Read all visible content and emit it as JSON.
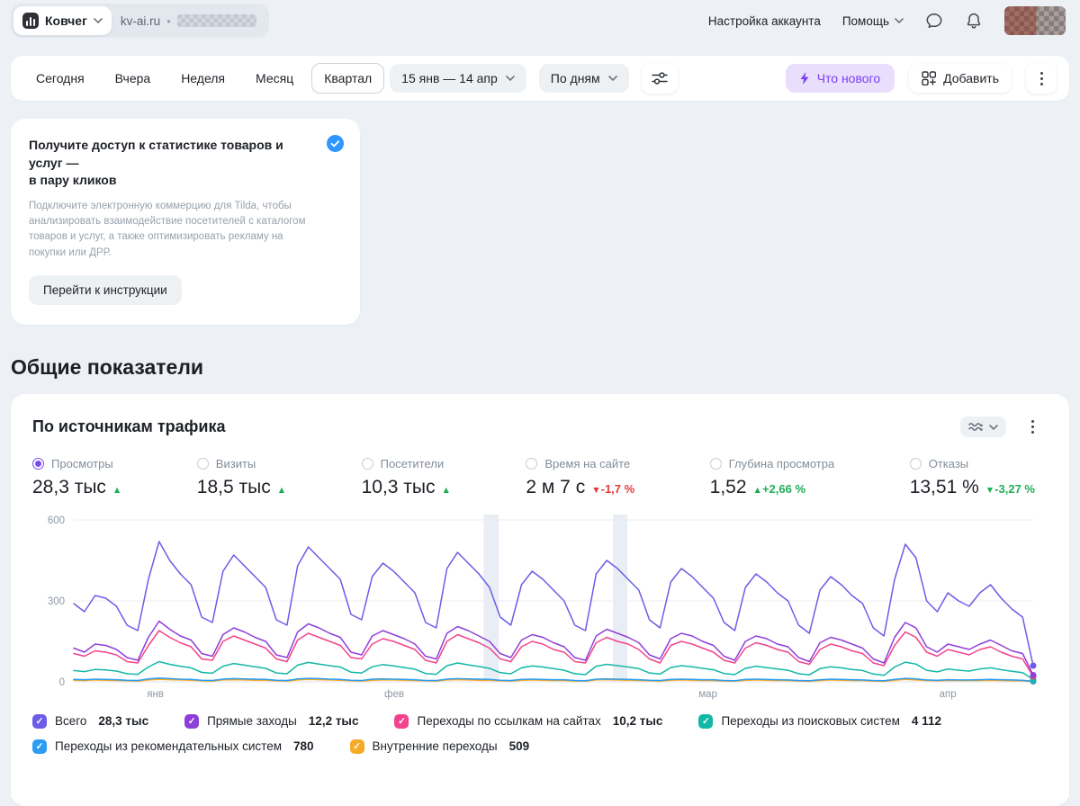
{
  "topbar": {
    "project_name": "Ковчег",
    "domain": "kv-ai.ru",
    "account_settings": "Настройка аккаунта",
    "help": "Помощь"
  },
  "toolbar": {
    "tabs": [
      {
        "label": "Сегодня",
        "active": false
      },
      {
        "label": "Вчера",
        "active": false
      },
      {
        "label": "Неделя",
        "active": false
      },
      {
        "label": "Месяц",
        "active": false
      },
      {
        "label": "Квартал",
        "active": true
      }
    ],
    "date_range": "15 янв — 14 апр",
    "granularity": "По дням",
    "whats_new": "Что нового",
    "add": "Добавить"
  },
  "promo": {
    "title_line1": "Получите доступ к статистике товаров и услуг —",
    "title_line2": "в пару кликов",
    "body": "Подключите электронную коммерцию для Tilda, чтобы анализировать взаимодействие посетителей с каталогом товаров и услуг, а также оптимизировать рекламу на покупки или ДРР.",
    "cta": "Перейти к инструкции"
  },
  "section_title": "Общие показатели",
  "card": {
    "title": "По источникам трафика",
    "metrics": [
      {
        "label": "Просмотры",
        "value": "28,3 тыс",
        "arrow": "▲",
        "delta": "",
        "trend_color": "#1fae55",
        "selected": true
      },
      {
        "label": "Визиты",
        "value": "18,5 тыс",
        "arrow": "▲",
        "delta": "",
        "trend_color": "#1fae55",
        "selected": false
      },
      {
        "label": "Посетители",
        "value": "10,3 тыс",
        "arrow": "▲",
        "delta": "",
        "trend_color": "#1fae55",
        "selected": false
      },
      {
        "label": "Время на сайте",
        "value": "2 м 7 с",
        "arrow": "▼",
        "delta": "-1,7 %",
        "trend_color": "#e8383d",
        "selected": false
      },
      {
        "label": "Глубина просмотра",
        "value": "1,52",
        "arrow": "▲",
        "delta": "+2,66 %",
        "trend_color": "#1fae55",
        "selected": false
      },
      {
        "label": "Отказы",
        "value": "13,51 %",
        "arrow": "▼",
        "delta": "-3,27 %",
        "trend_color": "#1fae55",
        "selected": false
      }
    ]
  },
  "colors": {
    "accent": "#7a4df0",
    "whats_new_bg": "#e9defc",
    "whats_new_text": "#7d3ff2",
    "positive": "#1fae55",
    "negative": "#e8383d",
    "promo_badge_blue": "#2e96ff"
  },
  "icons": {
    "project_logo": "metrica-bars",
    "chevrons": "chevron-down",
    "chat": "chat-bubble",
    "notifications": "bell",
    "filter": "sliders",
    "whats_new": "lightning",
    "add": "add-widget",
    "menu": "kebab",
    "chart_type": "waves",
    "promo_badge": "check-circle"
  },
  "chart_data": {
    "type": "line",
    "title": "По источникам трафика",
    "x_unit": "день",
    "date_range": "15 янв — 14 апр",
    "granularity": "По дням",
    "ylim": [
      0,
      600
    ],
    "yticks": [
      0,
      300,
      600
    ],
    "xticks": [
      {
        "label": "янв",
        "pos": 0.085
      },
      {
        "label": "фев",
        "pos": 0.334
      },
      {
        "label": "мар",
        "pos": 0.661
      },
      {
        "label": "апр",
        "pos": 0.911
      }
    ],
    "highlight_bands": [
      {
        "from": 0.427,
        "to": 0.443
      },
      {
        "from": 0.562,
        "to": 0.577
      }
    ],
    "grid": true,
    "legend_position": "bottom",
    "series": [
      {
        "name": "Всего",
        "total": "28,3 тыс",
        "color": "#6c5ce7",
        "values": [
          290,
          260,
          320,
          310,
          280,
          210,
          190,
          380,
          520,
          450,
          400,
          360,
          240,
          220,
          410,
          470,
          430,
          390,
          350,
          230,
          210,
          430,
          500,
          460,
          420,
          380,
          250,
          230,
          390,
          440,
          410,
          370,
          330,
          220,
          200,
          420,
          480,
          440,
          400,
          350,
          240,
          210,
          360,
          410,
          380,
          340,
          300,
          210,
          190,
          400,
          450,
          420,
          380,
          340,
          230,
          200,
          370,
          420,
          390,
          350,
          310,
          220,
          190,
          350,
          400,
          370,
          330,
          300,
          210,
          180,
          340,
          390,
          360,
          320,
          290,
          200,
          170,
          380,
          510,
          460,
          300,
          260,
          330,
          300,
          280,
          330,
          360,
          310,
          270,
          240,
          60
        ]
      },
      {
        "name": "Прямые заходы",
        "total": "12,2 тыс",
        "color": "#8e3fd9",
        "values": [
          125,
          110,
          140,
          135,
          120,
          90,
          80,
          165,
          225,
          195,
          170,
          155,
          105,
          95,
          175,
          200,
          185,
          165,
          150,
          100,
          90,
          185,
          215,
          200,
          180,
          165,
          110,
          100,
          170,
          190,
          175,
          160,
          140,
          95,
          85,
          180,
          205,
          190,
          170,
          150,
          105,
          90,
          155,
          175,
          165,
          145,
          130,
          90,
          80,
          170,
          195,
          180,
          165,
          145,
          100,
          85,
          160,
          180,
          170,
          150,
          135,
          95,
          80,
          150,
          170,
          160,
          140,
          130,
          90,
          75,
          145,
          165,
          155,
          140,
          125,
          85,
          70,
          165,
          220,
          200,
          130,
          110,
          140,
          130,
          120,
          140,
          155,
          135,
          115,
          105,
          25
        ]
      },
      {
        "name": "Переходы по ссылкам на сайтах",
        "total": "10,2 тыс",
        "color": "#f2438c",
        "values": [
          105,
          95,
          115,
          110,
          100,
          75,
          70,
          135,
          190,
          165,
          145,
          130,
          85,
          80,
          150,
          170,
          155,
          140,
          125,
          85,
          75,
          155,
          180,
          165,
          150,
          135,
          90,
          85,
          140,
          160,
          150,
          135,
          120,
          80,
          70,
          150,
          175,
          160,
          145,
          125,
          85,
          75,
          130,
          150,
          140,
          120,
          110,
          75,
          70,
          145,
          165,
          150,
          140,
          120,
          85,
          70,
          135,
          150,
          140,
          125,
          110,
          80,
          70,
          125,
          145,
          135,
          120,
          110,
          75,
          65,
          120,
          140,
          130,
          115,
          105,
          70,
          60,
          135,
          185,
          165,
          110,
          95,
          120,
          110,
          100,
          120,
          130,
          110,
          95,
          85,
          20
        ]
      },
      {
        "name": "Переходы из поисковых систем",
        "total": "4 112",
        "color": "#12b8a6",
        "values": [
          42,
          38,
          46,
          44,
          40,
          30,
          28,
          55,
          75,
          65,
          58,
          52,
          35,
          32,
          58,
          68,
          62,
          56,
          50,
          33,
          30,
          62,
          72,
          66,
          60,
          55,
          36,
          33,
          56,
          64,
          59,
          53,
          47,
          31,
          28,
          60,
          70,
          63,
          57,
          50,
          34,
          30,
          52,
          59,
          55,
          49,
          43,
          30,
          27,
          58,
          65,
          60,
          55,
          49,
          33,
          29,
          53,
          60,
          56,
          50,
          45,
          31,
          27,
          50,
          58,
          53,
          48,
          43,
          30,
          26,
          49,
          56,
          52,
          46,
          42,
          29,
          24,
          55,
          73,
          66,
          43,
          37,
          48,
          43,
          40,
          48,
          52,
          45,
          39,
          34,
          9
        ]
      },
      {
        "name": "Переходы из рекомендательных систем",
        "total": "780",
        "color": "#2b9cf2",
        "values": [
          9,
          8,
          10,
          9,
          8,
          6,
          5,
          11,
          14,
          12,
          10,
          9,
          6,
          5,
          10,
          12,
          11,
          10,
          9,
          6,
          5,
          11,
          13,
          12,
          10,
          9,
          6,
          5,
          10,
          11,
          10,
          9,
          8,
          5,
          5,
          10,
          12,
          11,
          10,
          9,
          6,
          5,
          9,
          10,
          9,
          8,
          8,
          5,
          4,
          10,
          11,
          10,
          9,
          8,
          6,
          5,
          9,
          10,
          9,
          8,
          8,
          5,
          4,
          9,
          10,
          9,
          8,
          7,
          5,
          4,
          8,
          10,
          9,
          8,
          7,
          5,
          4,
          9,
          13,
          11,
          7,
          6,
          8,
          7,
          7,
          8,
          9,
          8,
          7,
          6,
          2
        ]
      },
      {
        "name": "Внутренние переходы",
        "total": "509",
        "color": "#f7a928",
        "values": [
          6,
          5,
          7,
          6,
          5,
          4,
          3,
          7,
          9,
          8,
          7,
          6,
          4,
          3,
          7,
          8,
          7,
          6,
          6,
          4,
          3,
          7,
          9,
          8,
          7,
          6,
          4,
          3,
          6,
          7,
          7,
          6,
          5,
          4,
          3,
          7,
          8,
          7,
          6,
          6,
          4,
          3,
          6,
          7,
          6,
          5,
          5,
          3,
          3,
          7,
          8,
          7,
          6,
          5,
          4,
          3,
          6,
          7,
          6,
          5,
          5,
          3,
          3,
          6,
          7,
          6,
          5,
          5,
          3,
          2,
          5,
          7,
          6,
          5,
          5,
          3,
          2,
          6,
          9,
          7,
          5,
          4,
          5,
          5,
          5,
          5,
          6,
          5,
          4,
          4,
          1
        ]
      }
    ]
  }
}
